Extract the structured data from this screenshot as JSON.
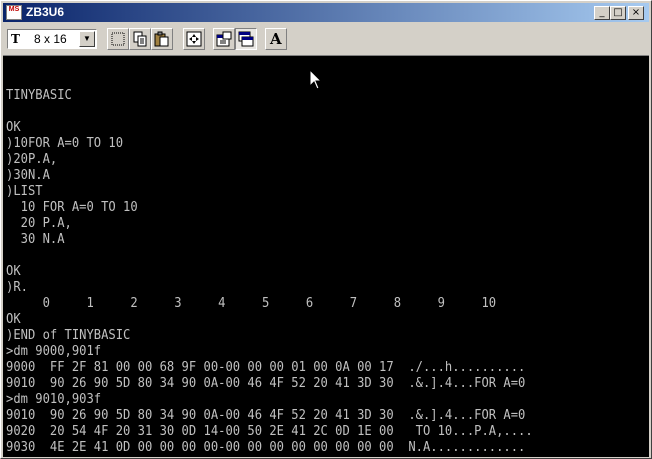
{
  "window": {
    "app_icon_text": "MS",
    "title": "ZB3U6",
    "buttons": {
      "minimize": "_",
      "maximize": "□",
      "close": "×"
    }
  },
  "toolbar": {
    "font_icon_text": "T",
    "font_size_value": "8 x 16",
    "font_dropdown_arrow": "▼",
    "font_tool_label": "A"
  },
  "console": {
    "lines": [
      "",
      "TINYBASIC",
      "",
      "OK",
      ")10FOR A=0 TO 10",
      ")20P.A,",
      ")30N.A",
      ")LIST",
      "  10 FOR A=0 TO 10",
      "  20 P.A,",
      "  30 N.A",
      "",
      "OK",
      ")R.",
      "     0     1     2     3     4     5     6     7     8     9     10",
      "OK",
      ")END of TINYBASIC",
      ">dm 9000,901f",
      "9000  FF 2F 81 00 00 68 9F 00-00 00 00 01 00 0A 00 17  ./...h..........",
      "9010  90 26 90 5D 80 34 90 0A-00 46 4F 52 20 41 3D 30  .&.].4...FOR A=0",
      ">dm 9010,903f",
      "9010  90 26 90 5D 80 34 90 0A-00 46 4F 52 20 41 3D 30  .&.].4...FOR A=0",
      "9020  20 54 4F 20 31 30 0D 14-00 50 2E 41 2C 0D 1E 00   TO 10...P.A,....",
      "9030  4E 2E 41 0D 00 00 00 00-00 00 00 00 00 00 00 00  N.A.............",
      ">"
    ]
  }
}
